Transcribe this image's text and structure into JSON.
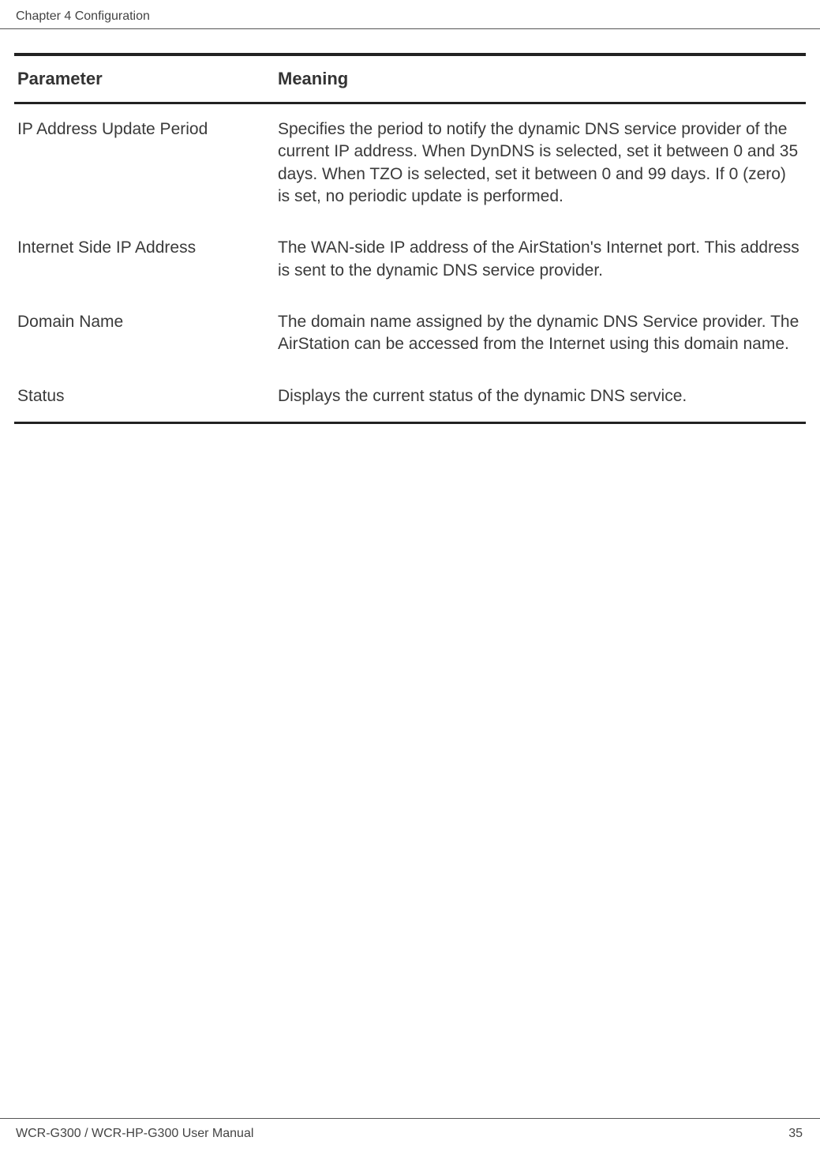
{
  "header": {
    "chapter": "Chapter 4  Configuration"
  },
  "table": {
    "headers": {
      "parameter": "Parameter",
      "meaning": "Meaning"
    },
    "rows": [
      {
        "parameter": "IP Address Update Period",
        "meaning": "Specifies the period to notify the dynamic DNS service provider of the current IP address. When DynDNS is selected, set it between 0 and 35 days. When TZO is selected, set it between 0 and 99 days. If 0 (zero) is set, no periodic update is performed."
      },
      {
        "parameter": "Internet Side IP Address",
        "meaning": "The WAN-side IP address of the AirStation's Internet port. This address is sent to the dynamic DNS service provider."
      },
      {
        "parameter": "Domain Name",
        "meaning": "The domain name assigned by the dynamic DNS Service provider. The AirStation can be accessed from the Internet using this domain name."
      },
      {
        "parameter": "Status",
        "meaning": "Displays the current status of the dynamic DNS service."
      }
    ]
  },
  "footer": {
    "manual_title": "WCR-G300 / WCR-HP-G300 User Manual",
    "page_number": "35"
  }
}
